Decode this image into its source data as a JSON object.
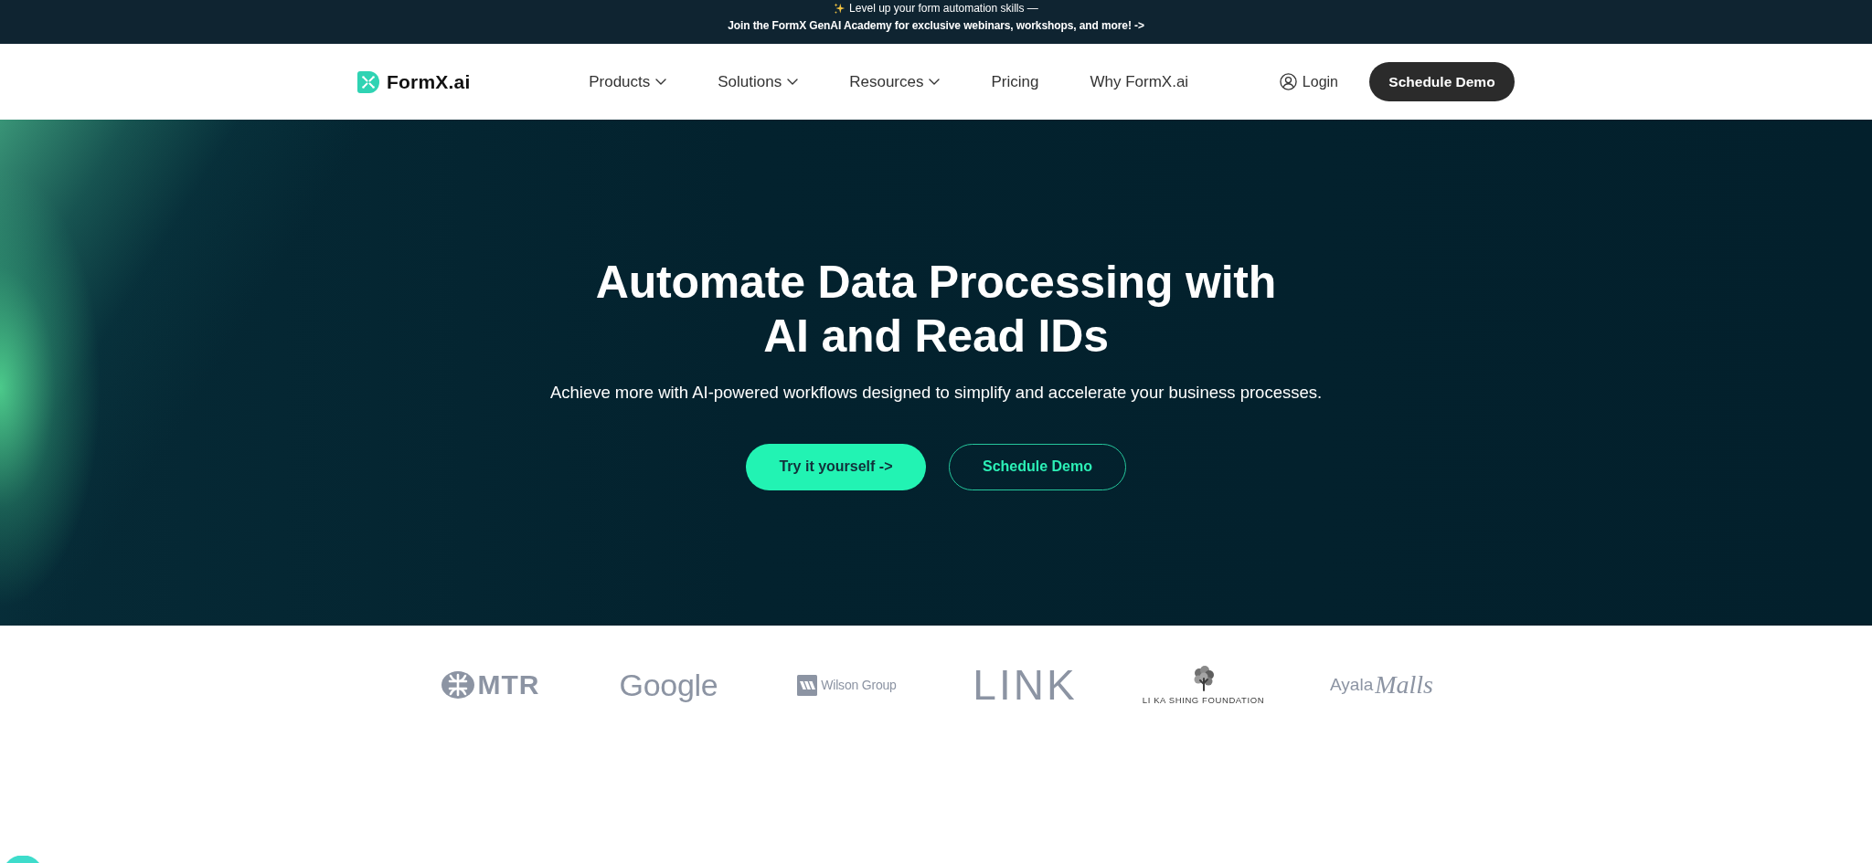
{
  "banner": {
    "text": "Level up your form automation skills —",
    "link": "Join the FormX GenAI Academy for exclusive webinars, workshops, and more! ->"
  },
  "nav": {
    "brand": "FormX.ai",
    "items": [
      {
        "label": "Products",
        "dropdown": true
      },
      {
        "label": "Solutions",
        "dropdown": true
      },
      {
        "label": "Resources",
        "dropdown": true
      },
      {
        "label": "Pricing",
        "dropdown": false
      },
      {
        "label": "Why FormX.ai",
        "dropdown": false
      }
    ],
    "login": "Login",
    "cta": "Schedule Demo"
  },
  "hero": {
    "title": "Automate Data Processing with AI and Read IDs",
    "subtitle": "Achieve more with AI-powered workflows designed to simplify and accelerate your business processes.",
    "buttons": [
      {
        "label": "Try it yourself ->",
        "kind": "primary"
      },
      {
        "label": "Schedule Demo",
        "kind": "outline"
      }
    ]
  },
  "logos": [
    {
      "kind": "roundel",
      "text": "MTR"
    },
    {
      "kind": "plain",
      "text": "Google"
    },
    {
      "kind": "boxed",
      "text": "Wilson Group"
    },
    {
      "kind": "thin",
      "text": "LINK"
    },
    {
      "kind": "tree",
      "text": "LI KA SHING FOUNDATION"
    },
    {
      "kind": "script",
      "text": "Ayala",
      "script_text": "Malls"
    }
  ]
}
